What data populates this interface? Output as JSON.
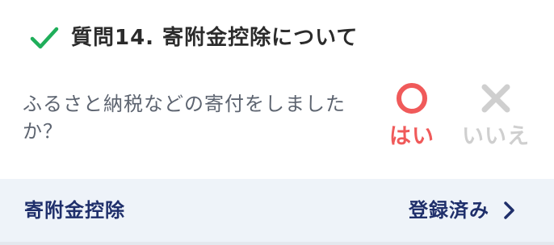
{
  "question": {
    "title": "質問14. 寄附金控除について",
    "text": "ふるさと納税などの寄付をしましたか？",
    "status_icon": "check-icon",
    "status_color": "#1fae5a"
  },
  "answers": {
    "yes": {
      "label": "はい",
      "icon": "circle-icon",
      "color": "#f05a5a",
      "selected": true
    },
    "no": {
      "label": "いいえ",
      "icon": "cross-icon",
      "color": "#cfcfcf",
      "selected": false
    }
  },
  "footer": {
    "title": "寄附金控除",
    "status": "登録済み",
    "icon": "chevron-right-icon",
    "background": "#eef3f9",
    "text_color": "#1f2f6b"
  }
}
